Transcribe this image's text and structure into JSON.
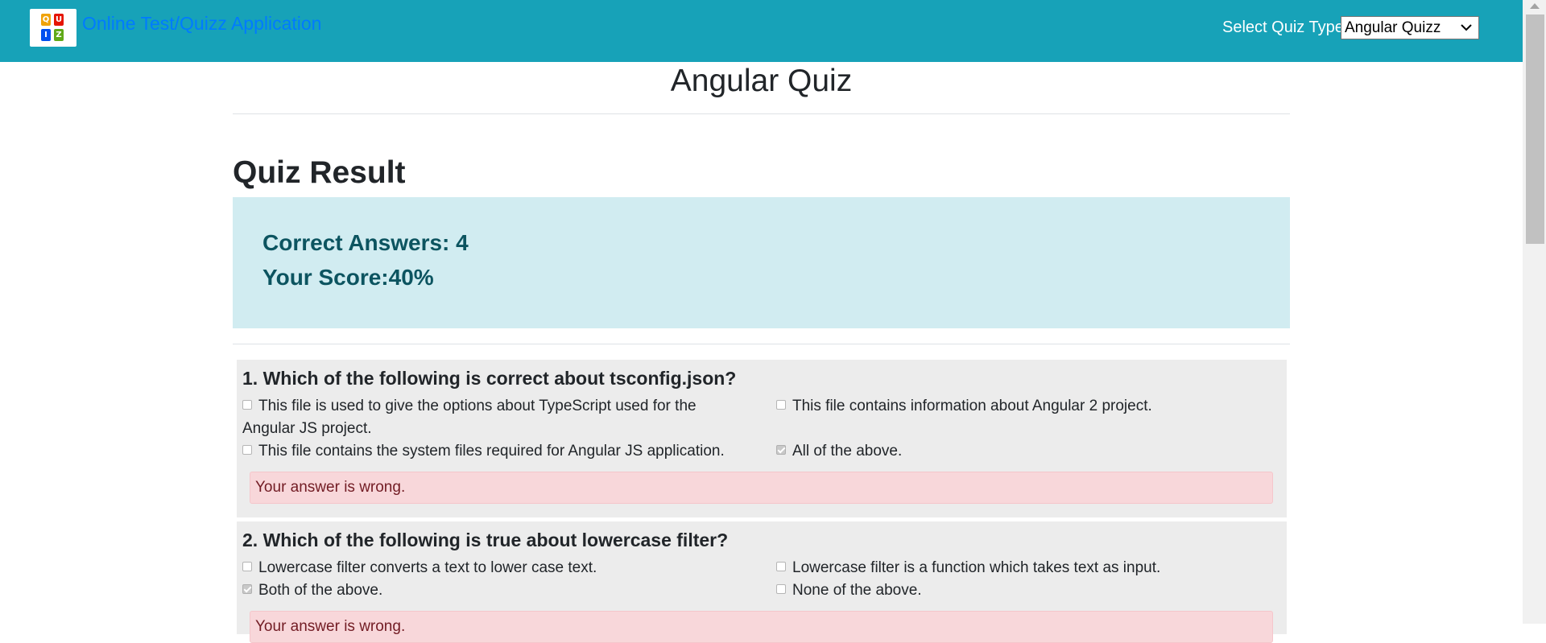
{
  "navbar": {
    "brand": "Online Test/Quizz Application",
    "logo_letters": [
      "Q",
      "U",
      "I",
      "Z"
    ],
    "quiz_type_label": "Select Quiz Type:",
    "quiz_type_selected": "Angular Quizz",
    "color": "#17a2b8"
  },
  "page": {
    "title": "Angular Quiz"
  },
  "result": {
    "heading": "Quiz Result",
    "correct_answers": "Correct Answers: 4",
    "score": "Your Score:40%"
  },
  "questions": [
    {
      "title": "1. Which of the following is correct about tsconfig.json?",
      "options": [
        {
          "label": "This file is used to give the options about TypeScript used for the Angular JS project.",
          "checked": false
        },
        {
          "label": "This file contains information about Angular 2 project.",
          "checked": false
        },
        {
          "label": "This file contains the system files required for Angular JS application.",
          "checked": false
        },
        {
          "label": "All of the above.",
          "checked": true
        }
      ],
      "feedback": "Your answer is wrong."
    },
    {
      "title": "2. Which of the following is true about lowercase filter?",
      "options": [
        {
          "label": "Lowercase filter converts a text to lower case text.",
          "checked": false
        },
        {
          "label": "Lowercase filter is a function which takes text as input.",
          "checked": false
        },
        {
          "label": "Both of the above.",
          "checked": true
        },
        {
          "label": "None of the above.",
          "checked": false
        }
      ],
      "feedback": "Your answer is wrong."
    }
  ]
}
